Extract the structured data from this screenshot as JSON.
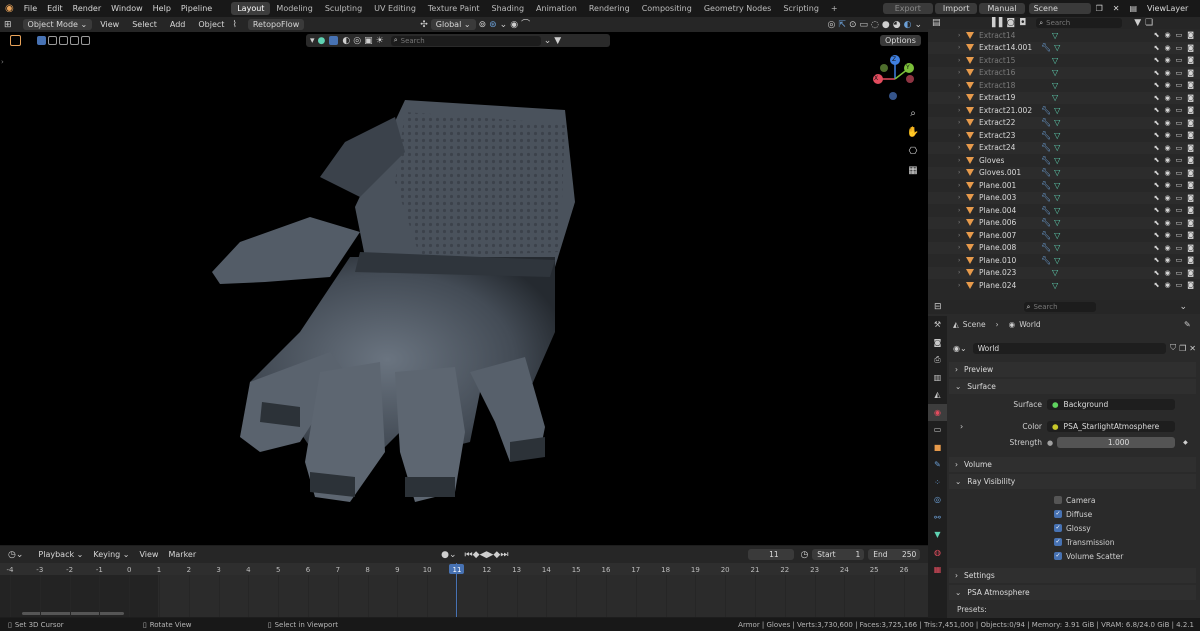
{
  "menu": {
    "items": [
      "File",
      "Edit",
      "Render",
      "Window",
      "Help",
      "Pipeline"
    ]
  },
  "workspaces": [
    "Layout",
    "Modeling",
    "Sculpting",
    "UV Editing",
    "Texture Paint",
    "Shading",
    "Animation",
    "Rendering",
    "Compositing",
    "Geometry Nodes",
    "Scripting"
  ],
  "topright": {
    "export": "Export",
    "import": "Import",
    "manual": "Manual",
    "scene": "Scene",
    "viewlayer": "ViewLayer"
  },
  "viewport_header": {
    "mode": "Object Mode",
    "view": "View",
    "select": "Select",
    "add": "Add",
    "object": "Object",
    "addon": "RetopoFlow",
    "orientation": "Global",
    "options": "Options",
    "search_placeholder": "Search"
  },
  "gizmo": {
    "x": "X",
    "y": "Y",
    "z": "Z"
  },
  "outliner": {
    "search_placeholder": "Search",
    "rows": [
      {
        "name": "Extract14",
        "dim": true,
        "mod": false
      },
      {
        "name": "Extract14.001",
        "dim": false,
        "mod": true
      },
      {
        "name": "Extract15",
        "dim": true,
        "mod": false
      },
      {
        "name": "Extract16",
        "dim": true,
        "mod": false
      },
      {
        "name": "Extract18",
        "dim": true,
        "mod": false
      },
      {
        "name": "Extract19",
        "dim": false,
        "mod": false
      },
      {
        "name": "Extract21.002",
        "dim": false,
        "mod": true
      },
      {
        "name": "Extract22",
        "dim": false,
        "mod": true
      },
      {
        "name": "Extract23",
        "dim": false,
        "mod": true
      },
      {
        "name": "Extract24",
        "dim": false,
        "mod": true
      },
      {
        "name": "Gloves",
        "dim": false,
        "mod": true
      },
      {
        "name": "Gloves.001",
        "dim": false,
        "mod": true
      },
      {
        "name": "Plane.001",
        "dim": false,
        "mod": true
      },
      {
        "name": "Plane.003",
        "dim": false,
        "mod": true
      },
      {
        "name": "Plane.004",
        "dim": false,
        "mod": true
      },
      {
        "name": "Plane.006",
        "dim": false,
        "mod": true
      },
      {
        "name": "Plane.007",
        "dim": false,
        "mod": true
      },
      {
        "name": "Plane.008",
        "dim": false,
        "mod": true
      },
      {
        "name": "Plane.010",
        "dim": false,
        "mod": true
      },
      {
        "name": "Plane.023",
        "dim": false,
        "mod": false
      },
      {
        "name": "Plane.024",
        "dim": false,
        "mod": false
      }
    ]
  },
  "properties": {
    "search_placeholder": "Search",
    "breadcrumb": {
      "scene": "Scene",
      "world": "World"
    },
    "world_name": "World",
    "panels": {
      "preview": "Preview",
      "surface": "Surface",
      "volume": "Volume",
      "ray_visibility": "Ray Visibility",
      "settings": "Settings",
      "psa": "PSA Atmosphere"
    },
    "surface": {
      "surface_label": "Surface",
      "surface_value": "Background",
      "color_label": "Color",
      "color_value": "PSA_StarlightAtmosphere",
      "strength_label": "Strength",
      "strength_value": "1.000"
    },
    "ray": [
      {
        "label": "Camera",
        "checked": false
      },
      {
        "label": "Diffuse",
        "checked": true
      },
      {
        "label": "Glossy",
        "checked": true
      },
      {
        "label": "Transmission",
        "checked": true
      },
      {
        "label": "Volume Scatter",
        "checked": true
      }
    ],
    "presets": "Presets:"
  },
  "timeline": {
    "playback": "Playback",
    "keying": "Keying",
    "view": "View",
    "marker": "Marker",
    "current_frame": "11",
    "start_label": "Start",
    "start": "1",
    "end_label": "End",
    "end": "250",
    "ticks": [
      "-4",
      "-3",
      "-2",
      "-1",
      "0",
      "1",
      "2",
      "3",
      "4",
      "5",
      "6",
      "7",
      "8",
      "9",
      "10",
      "11",
      "12",
      "13",
      "14",
      "15",
      "16",
      "17",
      "18",
      "19",
      "20",
      "21",
      "22",
      "23",
      "24",
      "25",
      "26"
    ]
  },
  "status": {
    "cursor": "Set 3D Cursor",
    "rotate": "Rotate View",
    "select": "Select in Viewport",
    "stats": "Armor | Gloves | Verts:3,730,600 | Faces:3,725,166 | Tris:7,451,000 | Objects:0/94 | Memory: 3.91 GiB | VRAM: 6.8/24.0 GiB | 4.2.1"
  },
  "colors": {
    "accent": "#4772b3",
    "object_orange": "#e79a4b",
    "mesh_teal": "#5fd3b3",
    "modifier_blue": "#6b9fd6"
  }
}
